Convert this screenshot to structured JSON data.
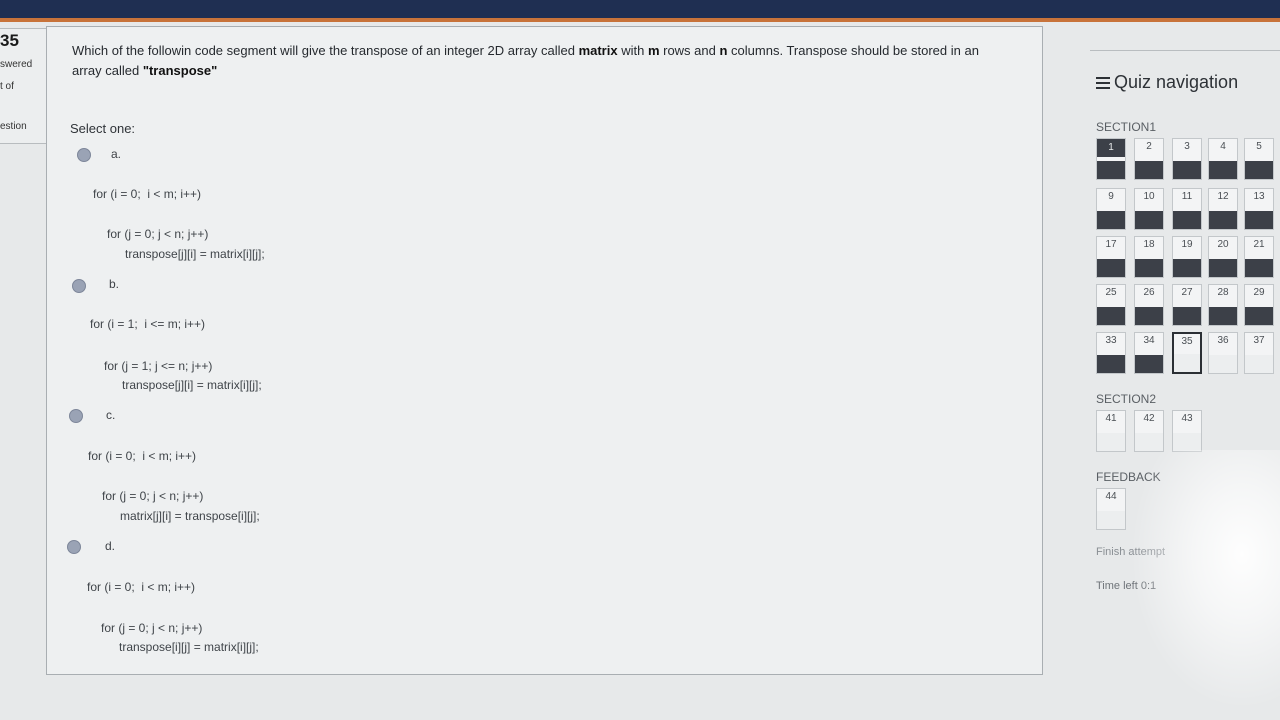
{
  "left_info": {
    "qnum": "35",
    "line1": "swered",
    "line2": "t of",
    "line3": "estion"
  },
  "question": {
    "part1": "Which of the followin",
    "part2": " code segment will give the transpose of an integer 2D array called ",
    "matrix": "matrix",
    "part3": " with ",
    "m": "m",
    "part4": " rows and ",
    "n": "n",
    "part5": " columns. Transpose should be stored in an array called ",
    "transpose": "\"transpose\""
  },
  "prompt": "Select one:",
  "options": [
    {
      "label": "a.",
      "line1": "for (i = 0;  i < m; i++)",
      "line2": "for (j = 0; j < n; j++)",
      "line3": "transpose[j][i] = matrix[i][j];"
    },
    {
      "label": "b.",
      "line1": "for (i = 1;  i <= m; i++)",
      "line2": "for (j = 1; j <= n; j++)",
      "line3": "transpose[j][i] = matrix[i][j];"
    },
    {
      "label": "c.",
      "line1": "for (i = 0;  i < m; i++)",
      "line2": "for (j = 0; j < n; j++)",
      "line3": "matrix[j][i] = transpose[i][j];"
    },
    {
      "label": "d.",
      "line1": "for (i = 0;  i < m; i++)",
      "line2": "for (j = 0; j < n; j++)",
      "line3": "transpose[i][j] = matrix[i][j];"
    }
  ],
  "nav": {
    "title": "Quiz navigation",
    "section1": "SECTION1",
    "section2": "SECTION2",
    "feedback": "FEEDBACK",
    "rows": [
      [
        "1",
        "2",
        "3",
        "4",
        "5"
      ],
      [
        "9",
        "10",
        "11",
        "12",
        "13"
      ],
      [
        "17",
        "18",
        "19",
        "20",
        "21"
      ],
      [
        "25",
        "26",
        "27",
        "28",
        "29"
      ],
      [
        "33",
        "34",
        "35",
        "36",
        "37"
      ]
    ],
    "current": "35",
    "section2_items": [
      "41",
      "42",
      "43"
    ],
    "feedback_items": [
      "44"
    ],
    "finish": "Finish attempt",
    "time_left": "Time left 0:1"
  }
}
